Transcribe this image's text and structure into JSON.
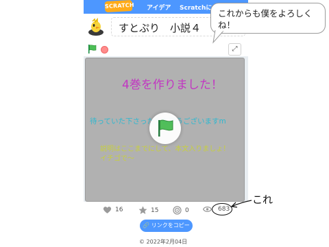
{
  "navbar": {
    "logo": "SCRATCH",
    "items": [
      "アイデア",
      "Scratchについて"
    ]
  },
  "project": {
    "title": "すとぷり　小説４"
  },
  "stage": {
    "title": "4巻を作りました！",
    "thanks": "待っていた下さった方有難うございますm",
    "note": "説明はここまでにして、本文入りましょ！\nイチゴで〜"
  },
  "stats": {
    "loves": "16",
    "favorites": "15",
    "remixes": "0",
    "views": "683"
  },
  "copy_link_label": "リンクをコピー",
  "date": "2022年2月04日",
  "date_prefix": "©",
  "bubble_text": "これからも僕をよろしくね！",
  "annotation": "これ",
  "colors": {
    "brand": "#4d97ff",
    "logo": "#ffab19",
    "title_text": "#c236c2",
    "thanks_text": "#2fb8d0",
    "note_text": "#c7cf3e",
    "stage_bg": "#b1b1b1"
  }
}
